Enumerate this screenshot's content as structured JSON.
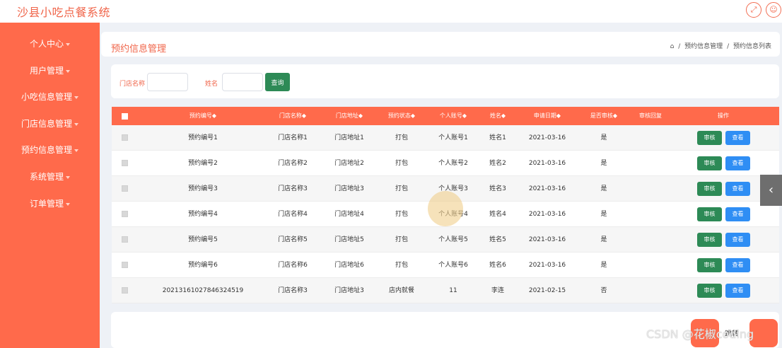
{
  "app": {
    "title": "沙县小吃点餐系统"
  },
  "topbar": {
    "icons": [
      "expand-icon",
      "user-icon"
    ]
  },
  "sidebar": {
    "items": [
      {
        "label": "个人中心"
      },
      {
        "label": "用户管理"
      },
      {
        "label": "小吃信息管理"
      },
      {
        "label": "门店信息管理"
      },
      {
        "label": "预约信息管理"
      },
      {
        "label": "系统管理"
      },
      {
        "label": "订单管理"
      }
    ]
  },
  "header": {
    "title": "预约信息管理",
    "breadcrumb": [
      "预约信息管理",
      "预约信息列表"
    ],
    "breadcrumb_sep": "/"
  },
  "search": {
    "store_label": "门店名称",
    "store_value": "",
    "name_label": "姓名",
    "name_value": "",
    "query_label": "查询"
  },
  "table": {
    "columns": [
      "预约编号◆",
      "门店名称◆",
      "门店地址◆",
      "预约状态◆",
      "个人账号◆",
      "姓名◆",
      "申请日期◆",
      "是否审核◆",
      "审核回复",
      "操作"
    ],
    "rows": [
      {
        "c0": "预约编号1",
        "c1": "门店名称1",
        "c2": "门店地址1",
        "c3": "打包",
        "c4": "个人账号1",
        "c5": "姓名1",
        "c6": "2021-03-16",
        "c7": "是",
        "c8": ""
      },
      {
        "c0": "预约编号2",
        "c1": "门店名称2",
        "c2": "门店地址2",
        "c3": "打包",
        "c4": "个人账号2",
        "c5": "姓名2",
        "c6": "2021-03-16",
        "c7": "是",
        "c8": ""
      },
      {
        "c0": "预约编号3",
        "c1": "门店名称3",
        "c2": "门店地址3",
        "c3": "打包",
        "c4": "个人账号3",
        "c5": "姓名3",
        "c6": "2021-03-16",
        "c7": "是",
        "c8": ""
      },
      {
        "c0": "预约编号4",
        "c1": "门店名称4",
        "c2": "门店地址4",
        "c3": "打包",
        "c4": "个人账号4",
        "c5": "姓名4",
        "c6": "2021-03-16",
        "c7": "是",
        "c8": ""
      },
      {
        "c0": "预约编号5",
        "c1": "门店名称5",
        "c2": "门店地址5",
        "c3": "打包",
        "c4": "个人账号5",
        "c5": "姓名5",
        "c6": "2021-03-16",
        "c7": "是",
        "c8": ""
      },
      {
        "c0": "预约编号6",
        "c1": "门店名称6",
        "c2": "门店地址6",
        "c3": "打包",
        "c4": "个人账号6",
        "c5": "姓名6",
        "c6": "2021-03-16",
        "c7": "是",
        "c8": ""
      },
      {
        "c0": "20213161027846324519",
        "c1": "门店名称3",
        "c2": "门店地址3",
        "c3": "店内就餐",
        "c4": "11",
        "c5": "李连",
        "c6": "2021-02-15",
        "c7": "否",
        "c8": ""
      }
    ],
    "actions": {
      "audit": "审核",
      "view": "查看"
    }
  },
  "pager": {
    "text": "跳转"
  },
  "watermark": "CSDN @花椒coding",
  "colors": {
    "accent": "#ff6a4b",
    "title": "#f0654a",
    "audit": "#2d8a56",
    "view": "#2f8ef4"
  }
}
